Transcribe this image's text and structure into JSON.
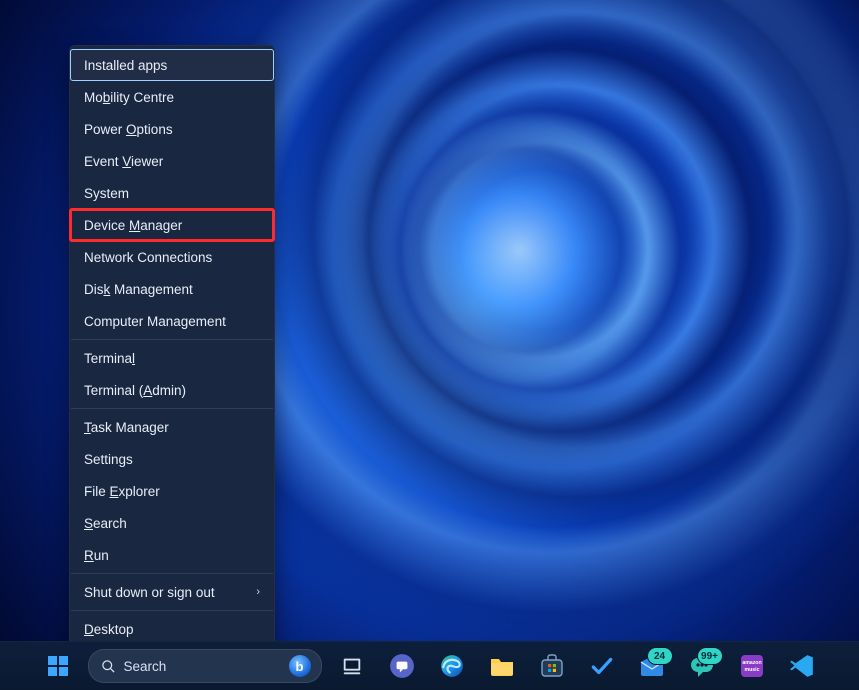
{
  "menu": {
    "items": [
      {
        "key": "installed-apps",
        "label": "Installed apps",
        "u": ""
      },
      {
        "key": "mobility-centre",
        "label": "Mobility Centre",
        "u": "b"
      },
      {
        "key": "power-options",
        "label": "Power Options",
        "u": "O"
      },
      {
        "key": "event-viewer",
        "label": "Event Viewer",
        "u": "V"
      },
      {
        "key": "system",
        "label": "System",
        "u": ""
      },
      {
        "key": "device-manager",
        "label": "Device Manager",
        "u": "M"
      },
      {
        "key": "network-connections",
        "label": "Network Connections",
        "u": ""
      },
      {
        "key": "disk-management",
        "label": "Disk Management",
        "u": "k"
      },
      {
        "key": "computer-management",
        "label": "Computer Management",
        "u": ""
      },
      {
        "key": "terminal",
        "label": "Terminal",
        "u": "l",
        "sep_before": true
      },
      {
        "key": "terminal-admin",
        "label": "Terminal (Admin)",
        "u": "A"
      },
      {
        "key": "task-manager",
        "label": "Task Manager",
        "u": "T",
        "sep_before": true
      },
      {
        "key": "settings",
        "label": "Settings",
        "u": "g"
      },
      {
        "key": "file-explorer",
        "label": "File Explorer",
        "u": "E"
      },
      {
        "key": "search",
        "label": "Search",
        "u": "S"
      },
      {
        "key": "run",
        "label": "Run",
        "u": "R"
      },
      {
        "key": "shutdown",
        "label": "Shut down or sign out",
        "u": "",
        "submenu": true,
        "sep_before": true
      },
      {
        "key": "desktop",
        "label": "Desktop",
        "u": "D",
        "sep_before": true
      }
    ],
    "focused": "installed-apps",
    "annotation_highlight": "device-manager"
  },
  "search": {
    "placeholder": "Search"
  },
  "taskbar": {
    "mail_badge": "24",
    "teams_badge": "99+"
  }
}
